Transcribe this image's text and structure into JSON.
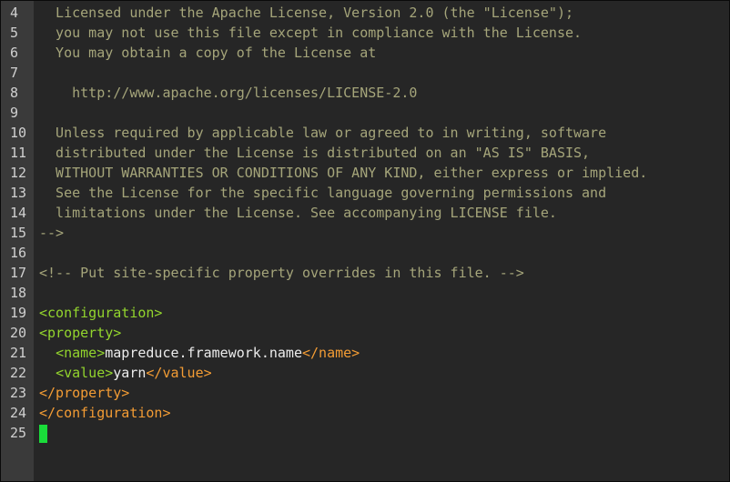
{
  "editor": {
    "lines": [
      {
        "num": "4",
        "segments": [
          {
            "t": "  Licensed under the Apache License, Version 2.0 (the \"License\");",
            "c": "comment"
          }
        ]
      },
      {
        "num": "5",
        "segments": [
          {
            "t": "  you may not use this file except in compliance with the License.",
            "c": "comment"
          }
        ]
      },
      {
        "num": "6",
        "segments": [
          {
            "t": "  You may obtain a copy of the License at",
            "c": "comment"
          }
        ]
      },
      {
        "num": "7",
        "segments": []
      },
      {
        "num": "8",
        "segments": [
          {
            "t": "    http://www.apache.org/licenses/LICENSE-2.0",
            "c": "comment"
          }
        ]
      },
      {
        "num": "9",
        "segments": []
      },
      {
        "num": "10",
        "segments": [
          {
            "t": "  Unless required by applicable law or agreed to in writing, software",
            "c": "comment"
          }
        ]
      },
      {
        "num": "11",
        "segments": [
          {
            "t": "  distributed under the License is distributed on an \"AS IS\" BASIS,",
            "c": "comment"
          }
        ]
      },
      {
        "num": "12",
        "segments": [
          {
            "t": "  WITHOUT WARRANTIES OR CONDITIONS OF ANY KIND, either express or implied.",
            "c": "comment"
          }
        ]
      },
      {
        "num": "13",
        "segments": [
          {
            "t": "  See the License for the specific language governing permissions and",
            "c": "comment"
          }
        ]
      },
      {
        "num": "14",
        "segments": [
          {
            "t": "  limitations under the License. See accompanying LICENSE file.",
            "c": "comment"
          }
        ]
      },
      {
        "num": "15",
        "segments": [
          {
            "t": "-->",
            "c": "comment"
          }
        ]
      },
      {
        "num": "16",
        "segments": []
      },
      {
        "num": "17",
        "segments": [
          {
            "t": "<!-- Put site-specific property overrides in this file. -->",
            "c": "comment"
          }
        ]
      },
      {
        "num": "18",
        "segments": []
      },
      {
        "num": "19",
        "segments": [
          {
            "t": "<configuration>",
            "c": "tag-open"
          }
        ]
      },
      {
        "num": "20",
        "segments": [
          {
            "t": "<property>",
            "c": "tag-open"
          }
        ]
      },
      {
        "num": "21",
        "segments": [
          {
            "t": "  ",
            "c": "text"
          },
          {
            "t": "<name>",
            "c": "tag-open"
          },
          {
            "t": "mapreduce.framework.name",
            "c": "text"
          },
          {
            "t": "</name>",
            "c": "tag-close"
          }
        ]
      },
      {
        "num": "22",
        "segments": [
          {
            "t": "  ",
            "c": "text"
          },
          {
            "t": "<value>",
            "c": "tag-open"
          },
          {
            "t": "yarn",
            "c": "text"
          },
          {
            "t": "</value>",
            "c": "tag-close"
          }
        ]
      },
      {
        "num": "23",
        "segments": [
          {
            "t": "</property>",
            "c": "tag-close"
          }
        ]
      },
      {
        "num": "24",
        "segments": [
          {
            "t": "</configuration>",
            "c": "tag-close"
          }
        ]
      },
      {
        "num": "25",
        "segments": [],
        "cursor": true
      }
    ]
  }
}
